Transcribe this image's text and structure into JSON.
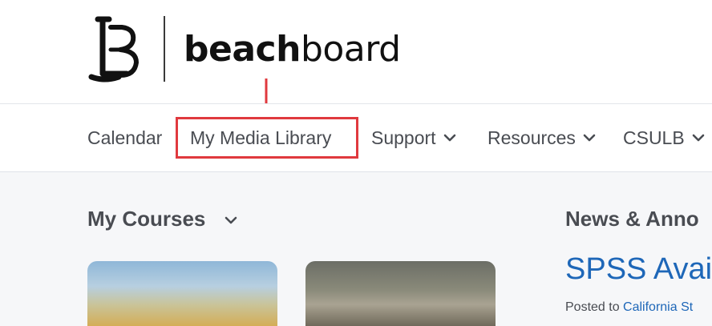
{
  "header": {
    "logo_part1": "beach",
    "logo_part2": "board"
  },
  "nav": {
    "items": [
      {
        "label": "Calendar",
        "has_menu": false
      },
      {
        "label": "My Media Library",
        "has_menu": false,
        "highlighted": true
      },
      {
        "label": "Support",
        "has_menu": true
      },
      {
        "label": "Resources",
        "has_menu": true
      },
      {
        "label": "CSULB",
        "has_menu": true
      }
    ],
    "highlight_color": "#e0393e"
  },
  "main": {
    "courses_title": "My Courses",
    "news_title": "News & Anno",
    "news_item_title": "SPSS Avail",
    "news_posted_prefix": "Posted to ",
    "news_posted_link": "California St"
  },
  "colors": {
    "text": "#494c52",
    "link": "#1e67b8",
    "background": "#f6f7f9"
  }
}
